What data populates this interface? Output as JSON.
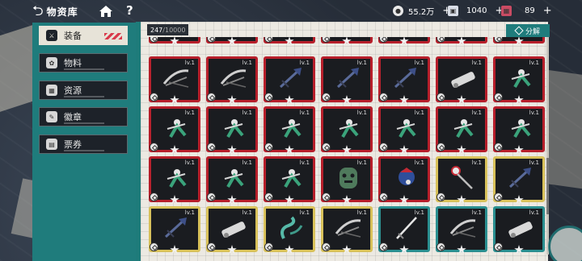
{
  "topbar": {
    "title": "物资库",
    "currencies": [
      {
        "icon": "coin-icon",
        "value": "55.2万"
      },
      {
        "icon": "ticket-icon",
        "value": "1040"
      },
      {
        "icon": "gift-icon",
        "value": "89"
      }
    ]
  },
  "sidebar": {
    "items": [
      {
        "label": "装备",
        "active": true
      },
      {
        "label": "物料",
        "active": false
      },
      {
        "label": "资源",
        "active": false
      },
      {
        "label": "徽章",
        "active": false
      },
      {
        "label": "票券",
        "active": false
      }
    ]
  },
  "inventory": {
    "count": "247",
    "capacity": "/10000",
    "decompose_label": "分解",
    "level_label": "lv.1",
    "rows": [
      [
        "red",
        "red",
        "red",
        "red",
        "red",
        "red",
        "red"
      ],
      [
        "red",
        "red",
        "red",
        "red",
        "red",
        "red",
        "red"
      ],
      [
        "red",
        "red",
        "red",
        "red",
        "red",
        "gold",
        "gold"
      ],
      [
        "gold",
        "gold",
        "gold",
        "gold",
        "teal",
        "teal",
        "teal"
      ]
    ],
    "art": [
      [
        "crossbow",
        "crossbow",
        "spear-blue",
        "spear-blue",
        "spear-blue",
        "cannon",
        "figure-green"
      ],
      [
        "figure-green",
        "figure-green",
        "figure-green",
        "figure-green",
        "figure-green",
        "figure-green",
        "figure-green"
      ],
      [
        "figure-green",
        "figure-green",
        "figure-green",
        "mask-green",
        "figure-blue",
        "staff",
        "spear-blue"
      ],
      [
        "spear-blue",
        "cannon",
        "serpent",
        "crossbow",
        "sword",
        "crossbow",
        "cannon"
      ]
    ]
  },
  "colors": {
    "accent": "#1f7c7c",
    "frame_red": "#b71f2b",
    "frame_gold": "#d8c15a",
    "frame_teal": "#2a8f90"
  }
}
